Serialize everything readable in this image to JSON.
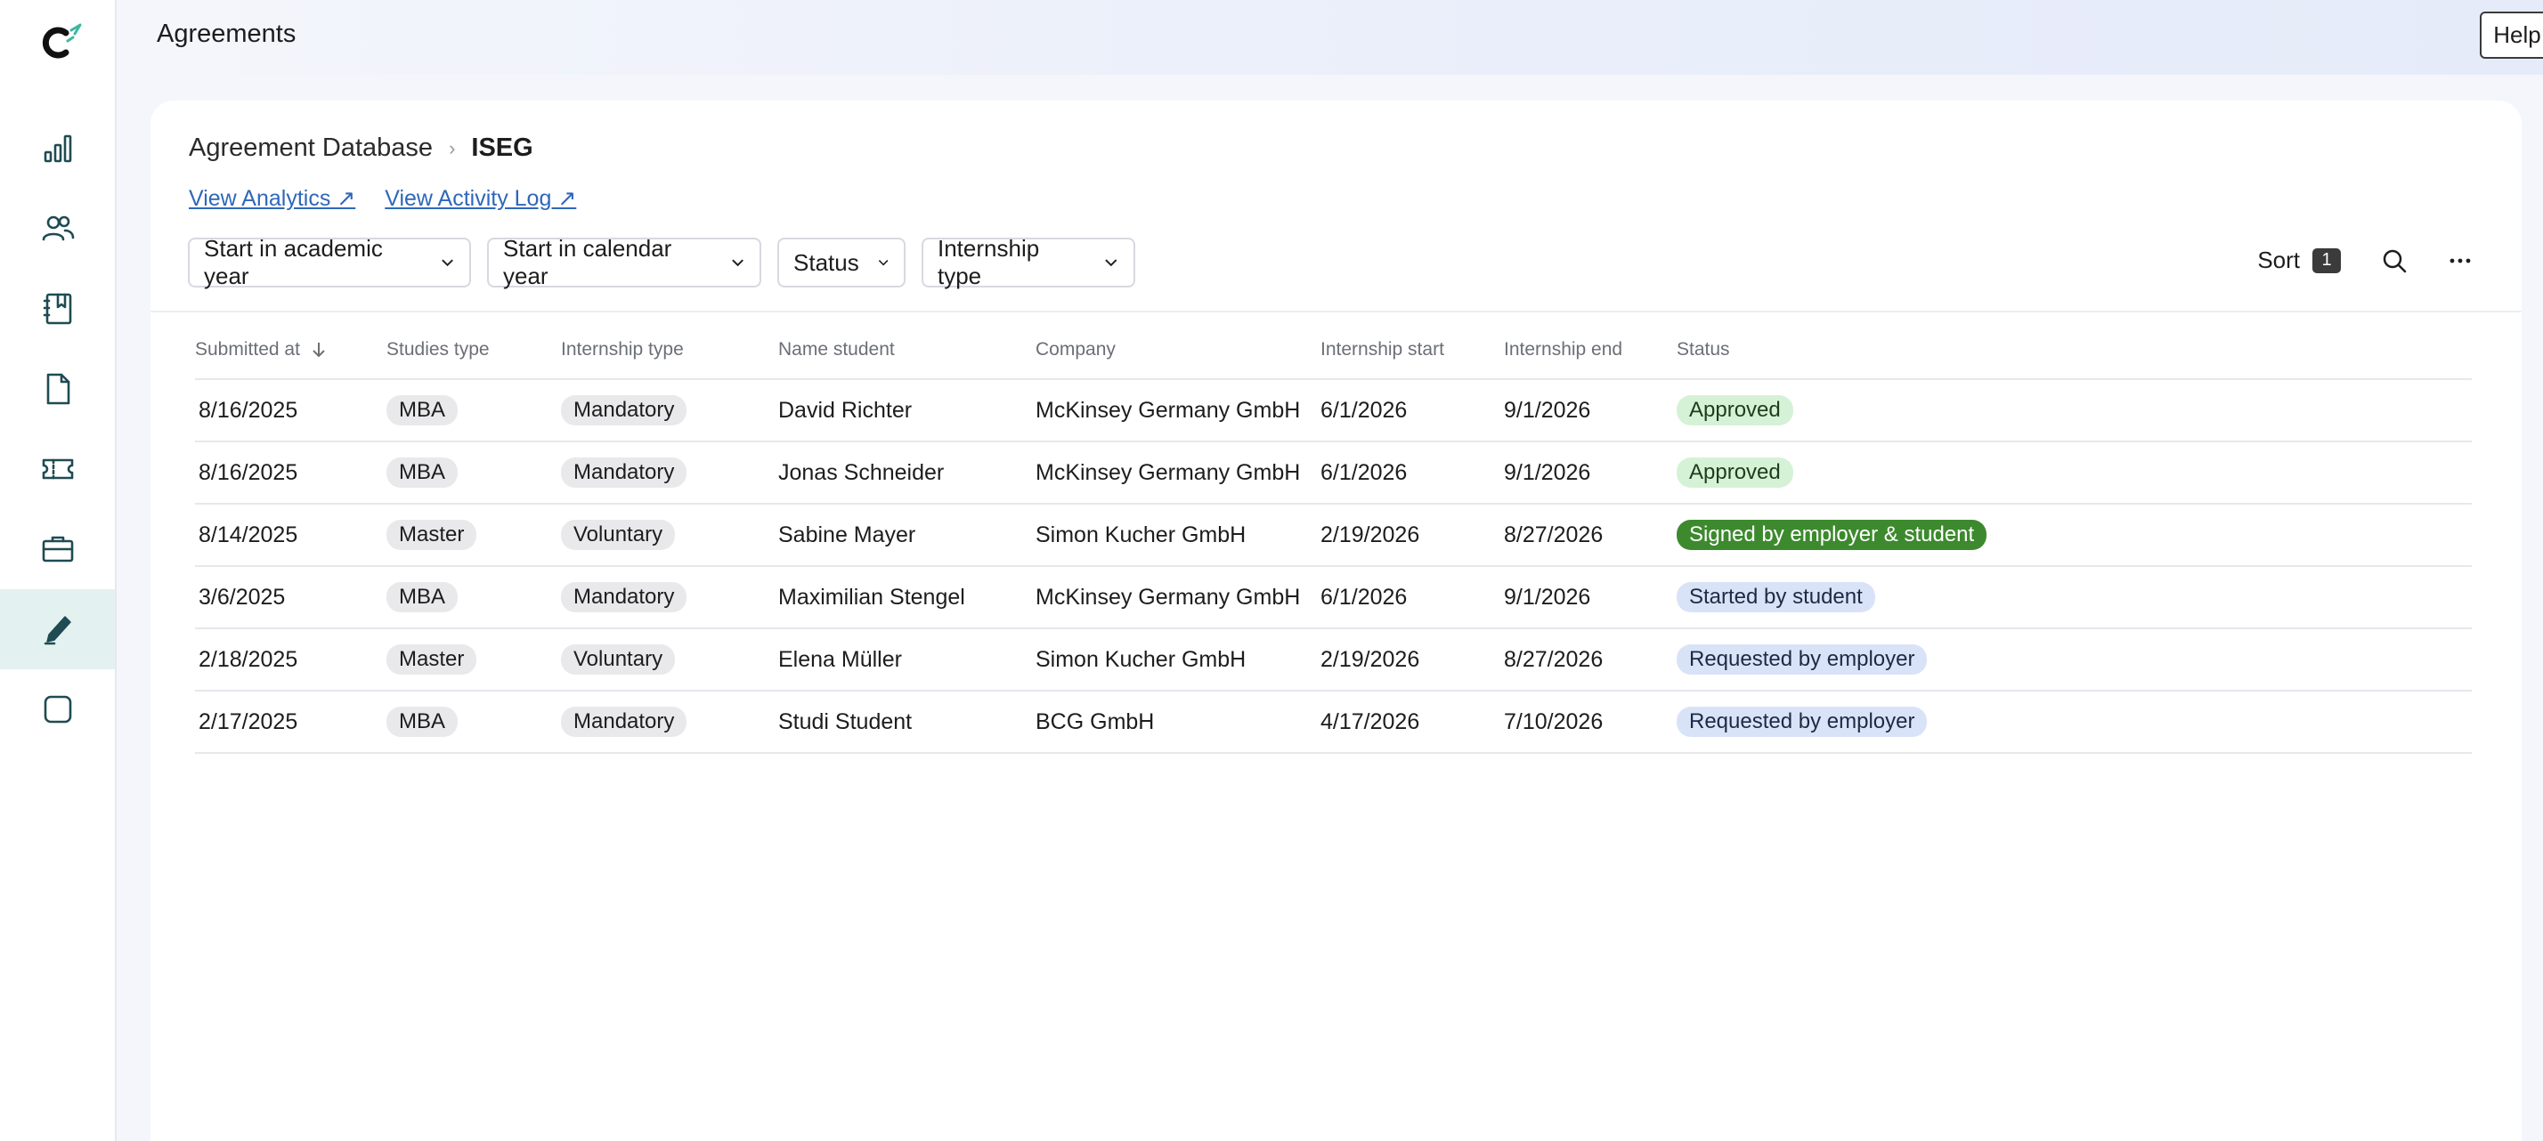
{
  "header": {
    "title": "Agreements",
    "help_label": "Help"
  },
  "sidebar": {
    "items": [
      {
        "icon": "bar-chart-icon",
        "active": false
      },
      {
        "icon": "users-icon",
        "active": false
      },
      {
        "icon": "notebook-icon",
        "active": false
      },
      {
        "icon": "document-icon",
        "active": false
      },
      {
        "icon": "ticket-icon",
        "active": false
      },
      {
        "icon": "briefcase-icon",
        "active": false
      },
      {
        "icon": "pen-icon",
        "active": true
      },
      {
        "icon": "square-icon",
        "active": false
      }
    ]
  },
  "breadcrumb": {
    "root": "Agreement Database",
    "current": "ISEG"
  },
  "links": {
    "analytics": "View Analytics ↗",
    "activity_log": "View Activity Log ↗"
  },
  "filters": {
    "academic_year": "Start in academic year",
    "calendar_year": "Start in calendar year",
    "status": "Status",
    "internship_type": "Internship type"
  },
  "toolbar": {
    "sort_label": "Sort",
    "sort_count": "1"
  },
  "table": {
    "columns": [
      "Submitted at",
      "Studies type",
      "Internship type",
      "Name student",
      "Company",
      "Internship start",
      "Internship end",
      "Status"
    ],
    "rows": [
      {
        "submitted": "8/16/2025",
        "studies": "MBA",
        "type": "Mandatory",
        "name": "David Richter",
        "company": "McKinsey Germany GmbH",
        "start": "6/1/2026",
        "end": "9/1/2026",
        "status": "Approved",
        "status_kind": "approved"
      },
      {
        "submitted": "8/16/2025",
        "studies": "MBA",
        "type": "Mandatory",
        "name": "Jonas Schneider",
        "company": "McKinsey Germany GmbH",
        "start": "6/1/2026",
        "end": "9/1/2026",
        "status": "Approved",
        "status_kind": "approved"
      },
      {
        "submitted": "8/14/2025",
        "studies": "Master",
        "type": "Voluntary",
        "name": "Sabine Mayer",
        "company": "Simon Kucher GmbH",
        "start": "2/19/2026",
        "end": "8/27/2026",
        "status": "Signed by employer & student",
        "status_kind": "signed"
      },
      {
        "submitted": "3/6/2025",
        "studies": "MBA",
        "type": "Mandatory",
        "name": "Maximilian Stengel",
        "company": "McKinsey Germany GmbH",
        "start": "6/1/2026",
        "end": "9/1/2026",
        "status": "Started by student",
        "status_kind": "info"
      },
      {
        "submitted": "2/18/2025",
        "studies": "Master",
        "type": "Voluntary",
        "name": "Elena Müller",
        "company": "Simon Kucher GmbH",
        "start": "2/19/2026",
        "end": "8/27/2026",
        "status": "Requested by employer",
        "status_kind": "info"
      },
      {
        "submitted": "2/17/2025",
        "studies": "MBA",
        "type": "Mandatory",
        "name": "Studi Student",
        "company": "BCG GmbH",
        "start": "4/17/2026",
        "end": "7/10/2026",
        "status": "Requested by employer",
        "status_kind": "info"
      }
    ]
  },
  "colors": {
    "accent_teal": "#1f4b52",
    "link_blue": "#2f67b9",
    "approved_bg": "#d6f2d6",
    "signed_bg": "#3d8a2e",
    "info_bg": "#d9e3f8"
  }
}
